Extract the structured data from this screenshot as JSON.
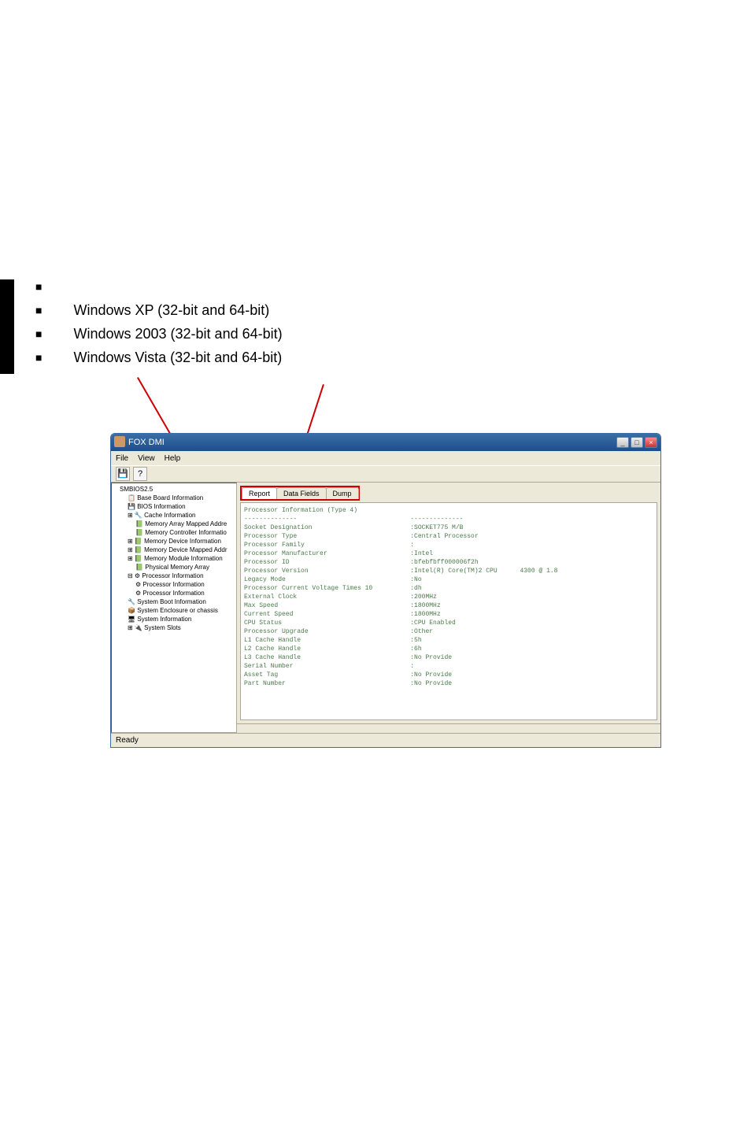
{
  "os_lines": {
    "xp": "Windows XP (32-bit and 64-bit)",
    "s2003": "Windows 2003 (32-bit and 64-bit)",
    "vista": "Windows Vista (32-bit and 64-bit)"
  },
  "window": {
    "title": "FOX DMI",
    "status": "Ready"
  },
  "menu": {
    "file": "File",
    "view": "View",
    "help": "Help"
  },
  "toolbar": {
    "save": "💾",
    "help": "?"
  },
  "tabs": {
    "report": "Report",
    "datafields": "Data Fields",
    "dump": "Dump"
  },
  "tree": {
    "root": "SMBIOS2.5",
    "items": [
      "Base Board Information",
      "BIOS Information",
      "Cache Information",
      "Memory Array Mapped Addre",
      "Memory Controller Informatio",
      "Memory Device Information",
      "Memory Device Mapped Addr",
      "Memory Module Information",
      "Physical Memory Array",
      "Processor Information",
      "Processor Information",
      "Processor Information",
      "System Boot Information",
      "System Enclosure or chassis",
      "System Information",
      "System Slots"
    ]
  },
  "report": {
    "title": "Processor Information (Type 4)",
    "sep": "--------------",
    "rows": [
      {
        "k": "Socket Designation",
        "v": ":SOCKET775 M/B"
      },
      {
        "k": "Processor Type",
        "v": ":Central Processor"
      },
      {
        "k": "Processor Family",
        "v": ":"
      },
      {
        "k": "Processor Manufacturer",
        "v": ":Intel"
      },
      {
        "k": "Processor ID",
        "v": ":bfebfbff000006f2h"
      },
      {
        "k": "Processor Version",
        "v": ":Intel(R) Core(TM)2 CPU      4300 @ 1.8"
      },
      {
        "k": "Legacy Mode",
        "v": ":No"
      },
      {
        "k": "Processor Current Voltage Times 10",
        "v": ":dh"
      },
      {
        "k": "External Clock",
        "v": ":200MHz"
      },
      {
        "k": "Max Speed",
        "v": ":1800MHz"
      },
      {
        "k": "Current Speed",
        "v": ":1800MHz"
      },
      {
        "k": "CPU Status",
        "v": ":CPU Enabled"
      },
      {
        "k": "Processor Upgrade",
        "v": ":Other"
      },
      {
        "k": "L1 Cache Handle",
        "v": ":5h"
      },
      {
        "k": "L2 Cache Handle",
        "v": ":6h"
      },
      {
        "k": "L3 Cache Handle",
        "v": ":No Provide"
      },
      {
        "k": "Serial Number",
        "v": ":"
      },
      {
        "k": "Asset Tag",
        "v": ":No Provide"
      },
      {
        "k": "Part Number",
        "v": ":No Provide"
      }
    ]
  }
}
